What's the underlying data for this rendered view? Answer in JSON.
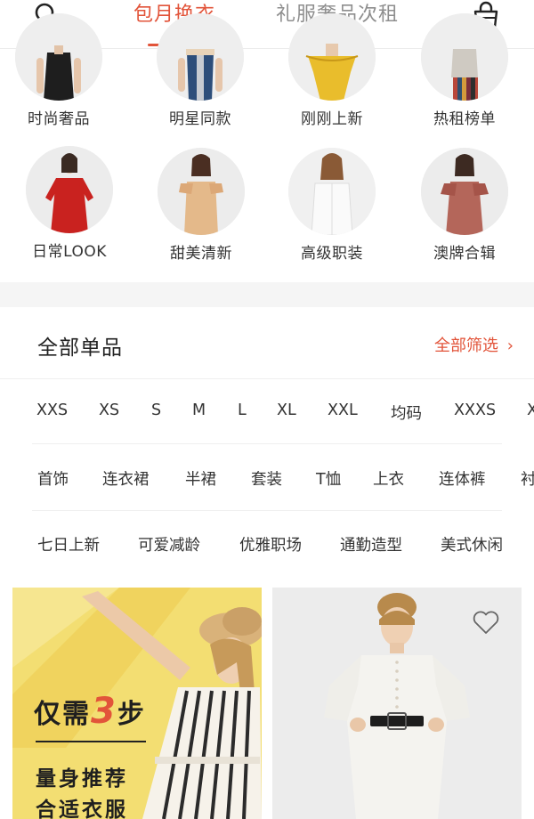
{
  "header": {
    "tab_active": "包月换衣",
    "tab_inactive": "礼服奢品次租"
  },
  "categories": [
    {
      "label": "时尚奢品"
    },
    {
      "label": "明星同款"
    },
    {
      "label": "刚刚上新"
    },
    {
      "label": "热租榜单"
    },
    {
      "label": "日常LOOK"
    },
    {
      "label": "甜美清新"
    },
    {
      "label": "高级职装"
    },
    {
      "label": "澳牌合辑"
    }
  ],
  "section": {
    "title": "全部单品",
    "filter_label": "全部筛选",
    "filter_arrow": "›"
  },
  "sizes": [
    "XXS",
    "XS",
    "S",
    "M",
    "L",
    "XL",
    "XXL",
    "均码",
    "XXXS",
    "X"
  ],
  "types": [
    "首饰",
    "连衣裙",
    "半裙",
    "套装",
    "T恤",
    "上衣",
    "连体裤",
    "衬"
  ],
  "styles": [
    "七日上新",
    "可爱减龄",
    "优雅职场",
    "通勤造型",
    "美式休闲"
  ],
  "promo": {
    "prefix": "仅需",
    "number": "3",
    "suffix": "步",
    "line2": "量身推荐",
    "line3": "合适衣服"
  },
  "colors": {
    "accent": "#e2543a",
    "promo_bg": "#f3de72"
  },
  "icons": {
    "search": "search-icon",
    "bag": "shopping-bag-icon",
    "heart": "heart-icon"
  }
}
